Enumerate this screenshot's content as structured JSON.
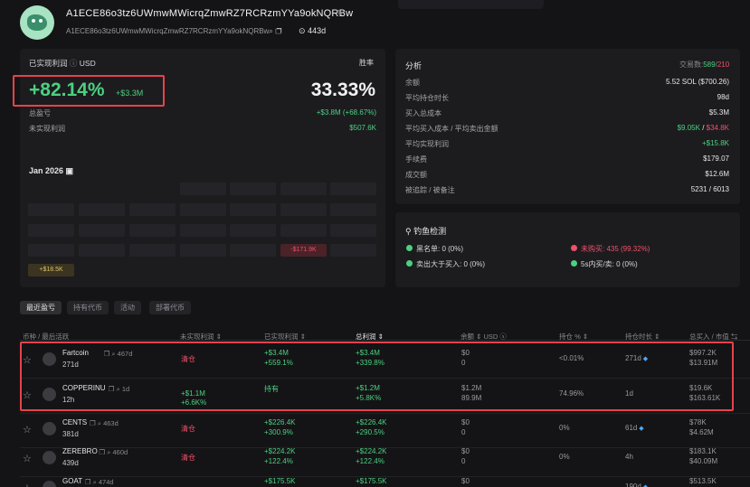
{
  "header": {
    "title": "A1ECE86o3tz6UWmwMWicrqZmwRZ7RCRzmYYa9okNQRBw",
    "sub_address": "A1ECE86o3tz6UWmwMWicrqZmwRZ7RCRzmYYa9okNQRBw",
    "followers": "443d",
    "edit_icon": "pencil-icon"
  },
  "pnl": {
    "label": "已实现利润",
    "currency": "USD",
    "winrate_label": "胜率",
    "percent": "+82.14%",
    "amount": "+$3.3M",
    "winrate": "33.33%",
    "total_label": "总盈亏",
    "total_value": "+$3.8M (+68.67%)",
    "unrealized_label": "未实现利润",
    "unrealized_value": "$507.6K",
    "month": "Jan 2026",
    "cell_neg": "-$171.9K",
    "cell_pos": "+$18.5K"
  },
  "analysis": {
    "title": "分析",
    "trades_label": "交易数:",
    "trades_win": "589",
    "trades_loss": "210",
    "rows": [
      {
        "label": "余额",
        "value": "5.52 SOL ($700.26)"
      },
      {
        "label": "平均持仓时长",
        "value": "98d"
      },
      {
        "label": "买入总成本",
        "value": "$5.3M"
      },
      {
        "label": "平均买入成本 / 平均卖出金额",
        "value_a": "$9.05K",
        "value_sep": " / ",
        "value_b": "$34.8K"
      },
      {
        "label": "平均实现利润",
        "value": "+$15.8K"
      },
      {
        "label": "手续费",
        "value": "$179.07"
      },
      {
        "label": "成交额",
        "value": "$12.6M"
      },
      {
        "label": "被追踪 / 被备注",
        "value": "5231 / 6013"
      }
    ]
  },
  "fish": {
    "title": "钓鱼检测",
    "blacklist": "黑名单: 0 (0%)",
    "unbought": "未购买: 435 (99.32%)",
    "sell_gt_buy": "卖出大于买入: 0 (0%)",
    "fast_trade": "5s内买/卖: 0 (0%)"
  },
  "tabs": [
    "最近盈亏",
    "持有代币",
    "活动",
    "部署代币"
  ],
  "columns": [
    "币种 / 最后活跃",
    "未实现利润",
    "已实现利润",
    "总利润",
    "余额",
    "USD",
    "持仓 %",
    "持仓时长",
    "总买入 / 市值"
  ],
  "rows": [
    {
      "name": "Fartcoin",
      "age": "467d",
      "last": "271d",
      "unrealized": "清仓",
      "realized_a": "+$3.4M",
      "realized_b": "+559.1%",
      "total_a": "+$3.4M",
      "total_b": "+339.8%",
      "bal_a": "$0",
      "bal_b": "0",
      "hold_pct": "<0.01%",
      "hold_time": "271d",
      "buy_a": "$997.2K",
      "buy_b": "$13.91M"
    },
    {
      "name": "COPPERINU",
      "age": "1d",
      "last": "12h",
      "unrealized": "+$1.1M",
      "unrealized_b": "+6.6K%",
      "realized_a": "持有",
      "realized_b": "",
      "total_a": "+$1.2M",
      "total_b": "+5.8K%",
      "bal_a": "$1.2M",
      "bal_b": "89.9M",
      "hold_pct": "74.96%",
      "hold_time": "1d",
      "buy_a": "$19.6K",
      "buy_b": "$163.61K"
    },
    {
      "name": "CENTS",
      "age": "463d",
      "last": "381d",
      "unrealized": "清仓",
      "realized_a": "+$226.4K",
      "realized_b": "+300.9%",
      "total_a": "+$226.4K",
      "total_b": "+290.5%",
      "bal_a": "$0",
      "bal_b": "0",
      "hold_pct": "0%",
      "hold_time": "61d",
      "buy_a": "$78K",
      "buy_b": "$4.62M"
    },
    {
      "name": "ZEREBRO",
      "age": "460d",
      "last": "439d",
      "unrealized": "清仓",
      "realized_a": "+$224.2K",
      "realized_b": "+122.4%",
      "total_a": "+$224.2K",
      "total_b": "+122.4%",
      "bal_a": "$0",
      "bal_b": "0",
      "hold_pct": "0%",
      "hold_time": "4h",
      "buy_a": "$183.1K",
      "buy_b": "$40.09M"
    },
    {
      "name": "GOAT",
      "age": "474d",
      "last": "",
      "unrealized": "",
      "realized_a": "+$175.5K",
      "realized_b": "",
      "total_a": "+$175.5K",
      "total_b": "",
      "bal_a": "$0",
      "bal_b": "",
      "hold_pct": "",
      "hold_time": "190d",
      "buy_a": "$513.5K",
      "buy_b": ""
    }
  ],
  "colors": {
    "green": "#4cd080",
    "red": "#f0506a",
    "highlight": "#e5434d"
  }
}
